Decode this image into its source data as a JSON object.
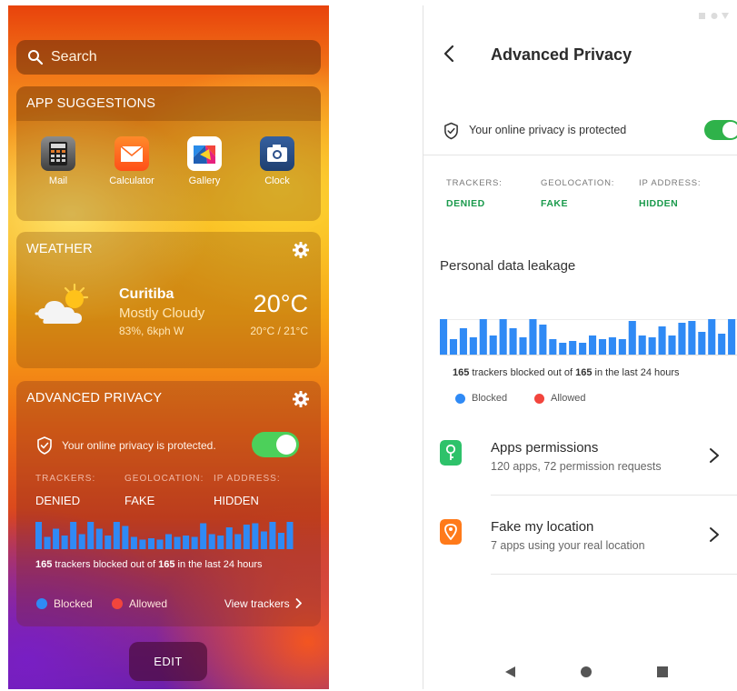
{
  "home_screen": {
    "search": {
      "placeholder": "Search",
      "icon": "search-icon"
    },
    "app_suggestions": {
      "title": "APP SUGGESTIONS",
      "apps": [
        {
          "label": "Mail",
          "icon": "calculator-icon",
          "color": "#585858"
        },
        {
          "label": "Calculator",
          "icon": "mail-icon",
          "color": "#ff6a1e"
        },
        {
          "label": "Gallery",
          "icon": "gallery-icon",
          "color": "#ffffff"
        },
        {
          "label": "Clock",
          "icon": "camera-icon",
          "color": "#2b4f8a"
        }
      ]
    },
    "weather": {
      "title": "WEATHER",
      "city": "Curitiba",
      "condition": "Mostly Cloudy",
      "details": "83%, 6kph W",
      "temperature": "20°C",
      "range": "20°C / 21°C",
      "icon": "partly-cloudy-icon"
    },
    "privacy_widget": {
      "title": "ADVANCED PRIVACY",
      "status": "Your online privacy is protected.",
      "toggle_on": true,
      "metrics": [
        {
          "label": "TRACKERS:",
          "value": "DENIED"
        },
        {
          "label": "GEOLOCATION:",
          "value": "FAKE"
        },
        {
          "label": "IP ADDRESS:",
          "value": "HIDDEN"
        }
      ],
      "tracker_count": "165",
      "tracker_mid": " trackers blocked out of ",
      "tracker_total": "165",
      "tracker_tail": " in the last 24 hours",
      "legend_blocked": "Blocked",
      "legend_allowed": "Allowed",
      "view_trackers": "View trackers"
    },
    "edit_label": "EDIT"
  },
  "privacy_screen": {
    "title": "Advanced Privacy",
    "status": "Your online privacy is protected",
    "toggle_on": true,
    "metrics": [
      {
        "label": "TRACKERS:",
        "value": "DENIED"
      },
      {
        "label": "GEOLOCATION:",
        "value": "FAKE"
      },
      {
        "label": "IP ADDRESS:",
        "value": "HIDDEN"
      }
    ],
    "leakage_title": "Personal data leakage",
    "tracker_count": "165",
    "tracker_mid": " trackers blocked out of ",
    "tracker_total": "165",
    "tracker_tail": " in the last 24 hours",
    "legend_blocked": "Blocked",
    "legend_allowed": "Allowed",
    "list": [
      {
        "title": "Apps permissions",
        "subtitle": "120 apps, 72 permission requests",
        "icon": "key-icon",
        "color": "#2ec26a"
      },
      {
        "title": "Fake my location",
        "subtitle": "7 apps using your real location",
        "icon": "location-pin-icon",
        "color": "#ff7a1a"
      }
    ]
  },
  "colors": {
    "blocked": "#2f8af5",
    "allowed": "#f2453d",
    "toggle_on": "#2fb24a",
    "accent_green": "#1a9a4c"
  },
  "chart_data": [
    {
      "type": "bar",
      "categories": [],
      "series": [
        {
          "values": [
            1.0,
            0.45,
            0.75,
            0.5,
            1.0,
            0.55,
            1.0,
            0.75,
            0.5,
            1.0,
            0.85,
            0.45,
            0.35,
            0.4,
            0.35,
            0.55,
            0.45,
            0.5,
            0.45,
            0.95,
            0.55,
            0.5,
            0.8,
            0.55,
            0.9,
            0.95,
            0.65,
            1.0,
            0.6,
            1.0
          ]
        }
      ]
    },
    {
      "type": "bar",
      "categories": [],
      "series": [
        {
          "values": [
            1.0,
            0.45,
            0.75,
            0.5,
            1.0,
            0.55,
            1.0,
            0.75,
            0.5,
            1.0,
            0.85,
            0.45,
            0.35,
            0.4,
            0.35,
            0.55,
            0.45,
            0.5,
            0.45,
            0.95,
            0.55,
            0.5,
            0.8,
            0.55,
            0.9,
            0.95,
            0.65,
            1.0,
            0.6,
            1.0
          ]
        }
      ]
    }
  ]
}
